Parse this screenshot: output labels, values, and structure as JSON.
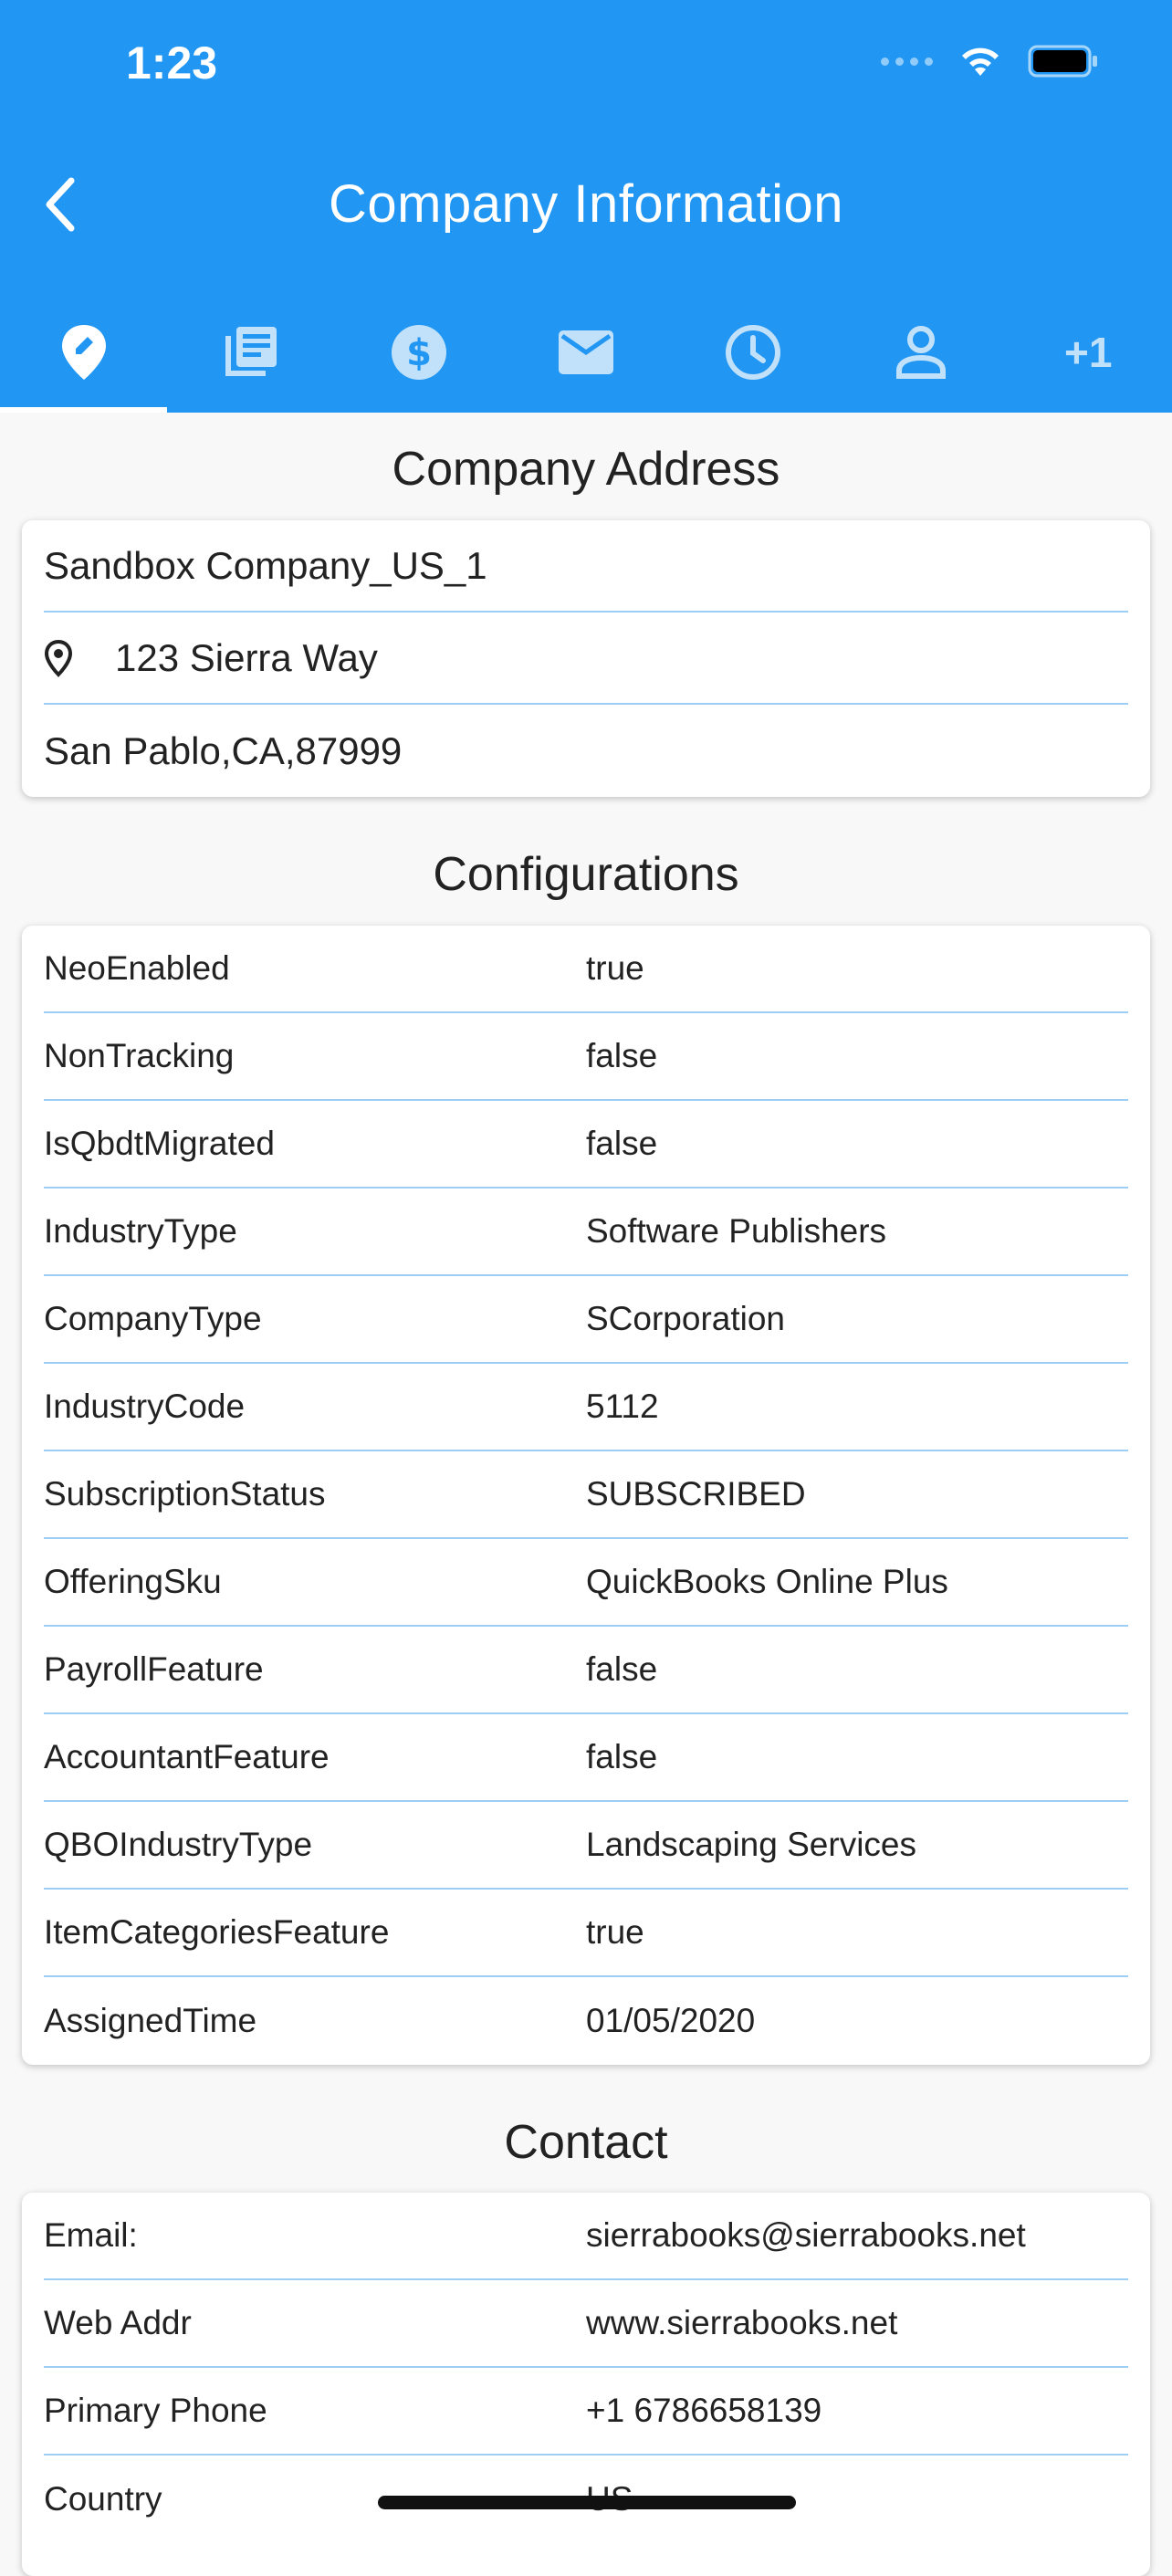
{
  "status_bar": {
    "time": "1:23"
  },
  "header": {
    "title": "Company Information",
    "accent_color": "#2196f3"
  },
  "tabs": [
    {
      "icon": "edit-location-icon",
      "active": true
    },
    {
      "icon": "news-icon"
    },
    {
      "icon": "dollar-icon"
    },
    {
      "icon": "mail-icon"
    },
    {
      "icon": "clock-icon"
    },
    {
      "icon": "person-icon"
    },
    {
      "label": "+1"
    }
  ],
  "address": {
    "title": "Company Address",
    "company_name": "Sandbox Company_US_1",
    "street": "123 Sierra Way",
    "city_line": "San Pablo,CA,87999"
  },
  "configurations": {
    "title": "Configurations",
    "rows": [
      {
        "key": "NeoEnabled",
        "value": "true"
      },
      {
        "key": "NonTracking",
        "value": "false"
      },
      {
        "key": "IsQbdtMigrated",
        "value": "false"
      },
      {
        "key": "IndustryType",
        "value": "Software Publishers"
      },
      {
        "key": "CompanyType",
        "value": "SCorporation"
      },
      {
        "key": "IndustryCode",
        "value": "5112"
      },
      {
        "key": "SubscriptionStatus",
        "value": "SUBSCRIBED"
      },
      {
        "key": "OfferingSku",
        "value": "QuickBooks Online Plus"
      },
      {
        "key": "PayrollFeature",
        "value": "false"
      },
      {
        "key": "AccountantFeature",
        "value": "false"
      },
      {
        "key": "QBOIndustryType",
        "value": "Landscaping Services"
      },
      {
        "key": "ItemCategoriesFeature",
        "value": "true"
      },
      {
        "key": "AssignedTime",
        "value": "01/05/2020"
      }
    ]
  },
  "contact": {
    "title": "Contact",
    "rows": [
      {
        "key": "Email:",
        "value": "sierrabooks@sierrabooks.net"
      },
      {
        "key": "Web Addr",
        "value": "www.sierrabooks.net"
      },
      {
        "key": "Primary Phone",
        "value": "+1 6786658139"
      },
      {
        "key": "Country",
        "value": "US"
      }
    ]
  }
}
